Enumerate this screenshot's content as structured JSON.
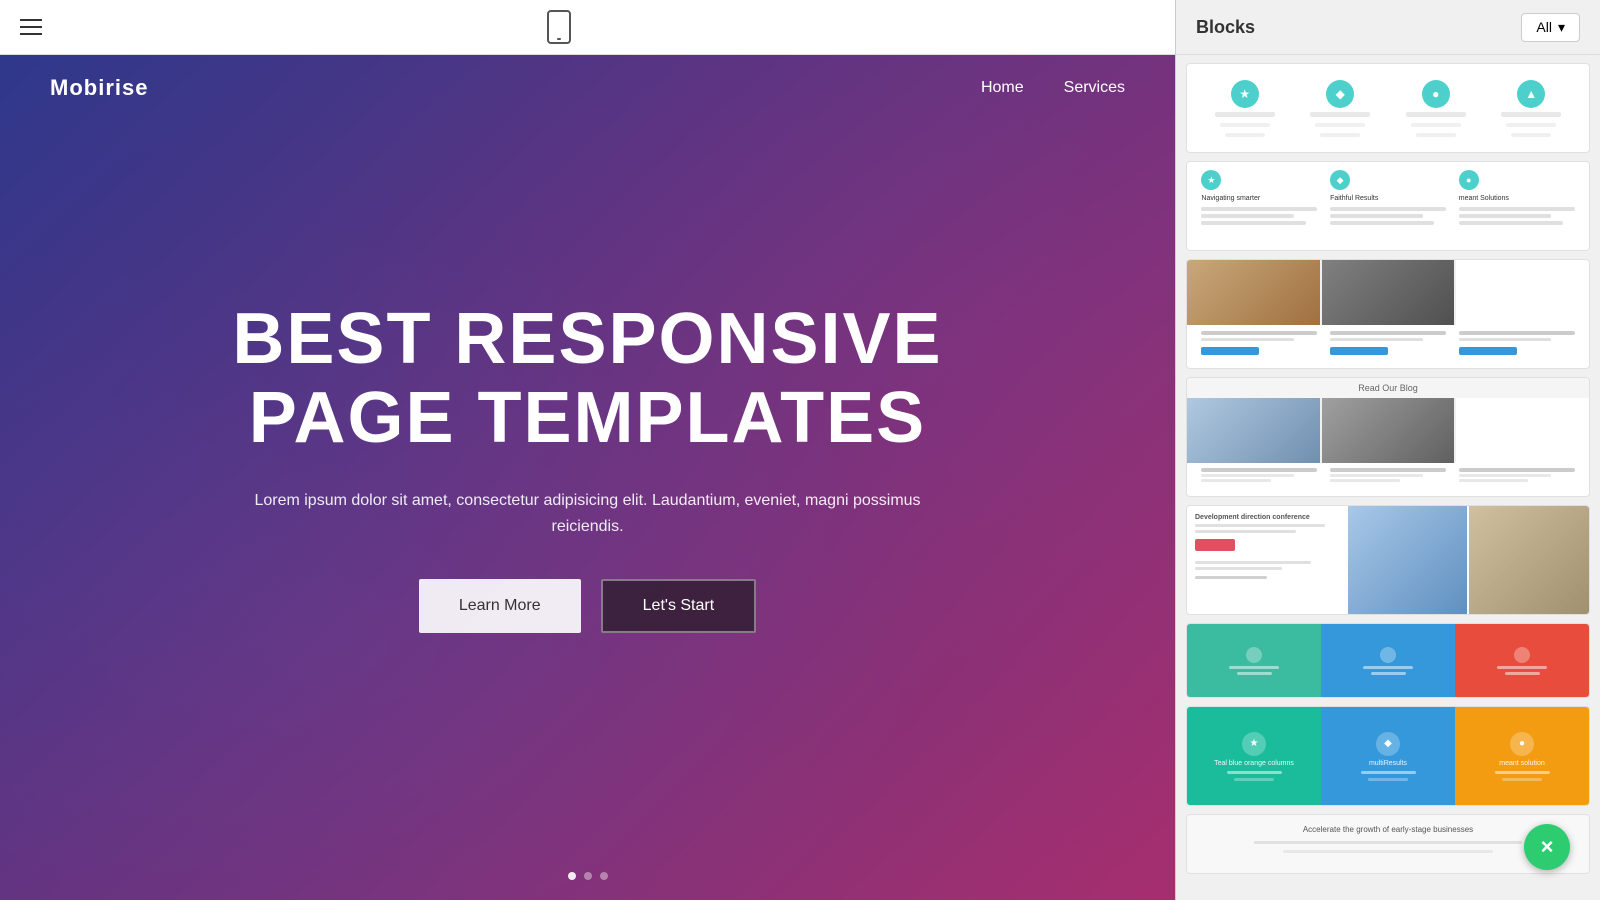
{
  "toolbar": {
    "hamburger_label": "menu",
    "device_label": "mobile preview"
  },
  "editor": {
    "navbar": {
      "brand": "Mobirise",
      "links": [
        {
          "label": "Home"
        },
        {
          "label": "Services"
        }
      ]
    },
    "hero": {
      "title_line1": "BEST RESPONSIVE",
      "title_line2": "PAGE TEMPLATES",
      "subtitle": "Lorem ipsum dolor sit amet, consectetur adipisicing elit. Laudantium, eveniet, magni possimus reiciendis.",
      "btn_learn": "Learn More",
      "btn_start": "Let's Start"
    }
  },
  "blocks_panel": {
    "title": "Blocks",
    "filter_label": "All",
    "block1": {
      "cols": [
        {
          "icon": "★",
          "color": "#4dd0cc"
        },
        {
          "icon": "◆",
          "color": "#4dd0cc"
        },
        {
          "icon": "●",
          "color": "#4dd0cc"
        },
        {
          "icon": "▲",
          "color": "#4dd0cc"
        }
      ]
    },
    "block2": {
      "label": "3-column teal icons",
      "cols": [
        {
          "icon": "★",
          "color": "#4dd0cc",
          "title": "Navigating smarter"
        },
        {
          "icon": "◆",
          "color": "#4dd0cc",
          "title": "Faithful Results"
        },
        {
          "icon": "●",
          "color": "#4dd0cc",
          "title": "meant Solutions"
        }
      ]
    },
    "block3": {
      "label": "3-column images with text"
    },
    "block4": {
      "label": "Read Our Blog",
      "header": "Read Our Blog"
    },
    "block5": {
      "label": "Development direction conference"
    },
    "block6": {
      "label": "3-column colored"
    },
    "block7": {
      "label": "Teal blue orange columns"
    },
    "block8": {
      "label": "Accelerate growth",
      "text": "Accelerate the growth of early-stage businesses"
    },
    "close_label": "×"
  }
}
